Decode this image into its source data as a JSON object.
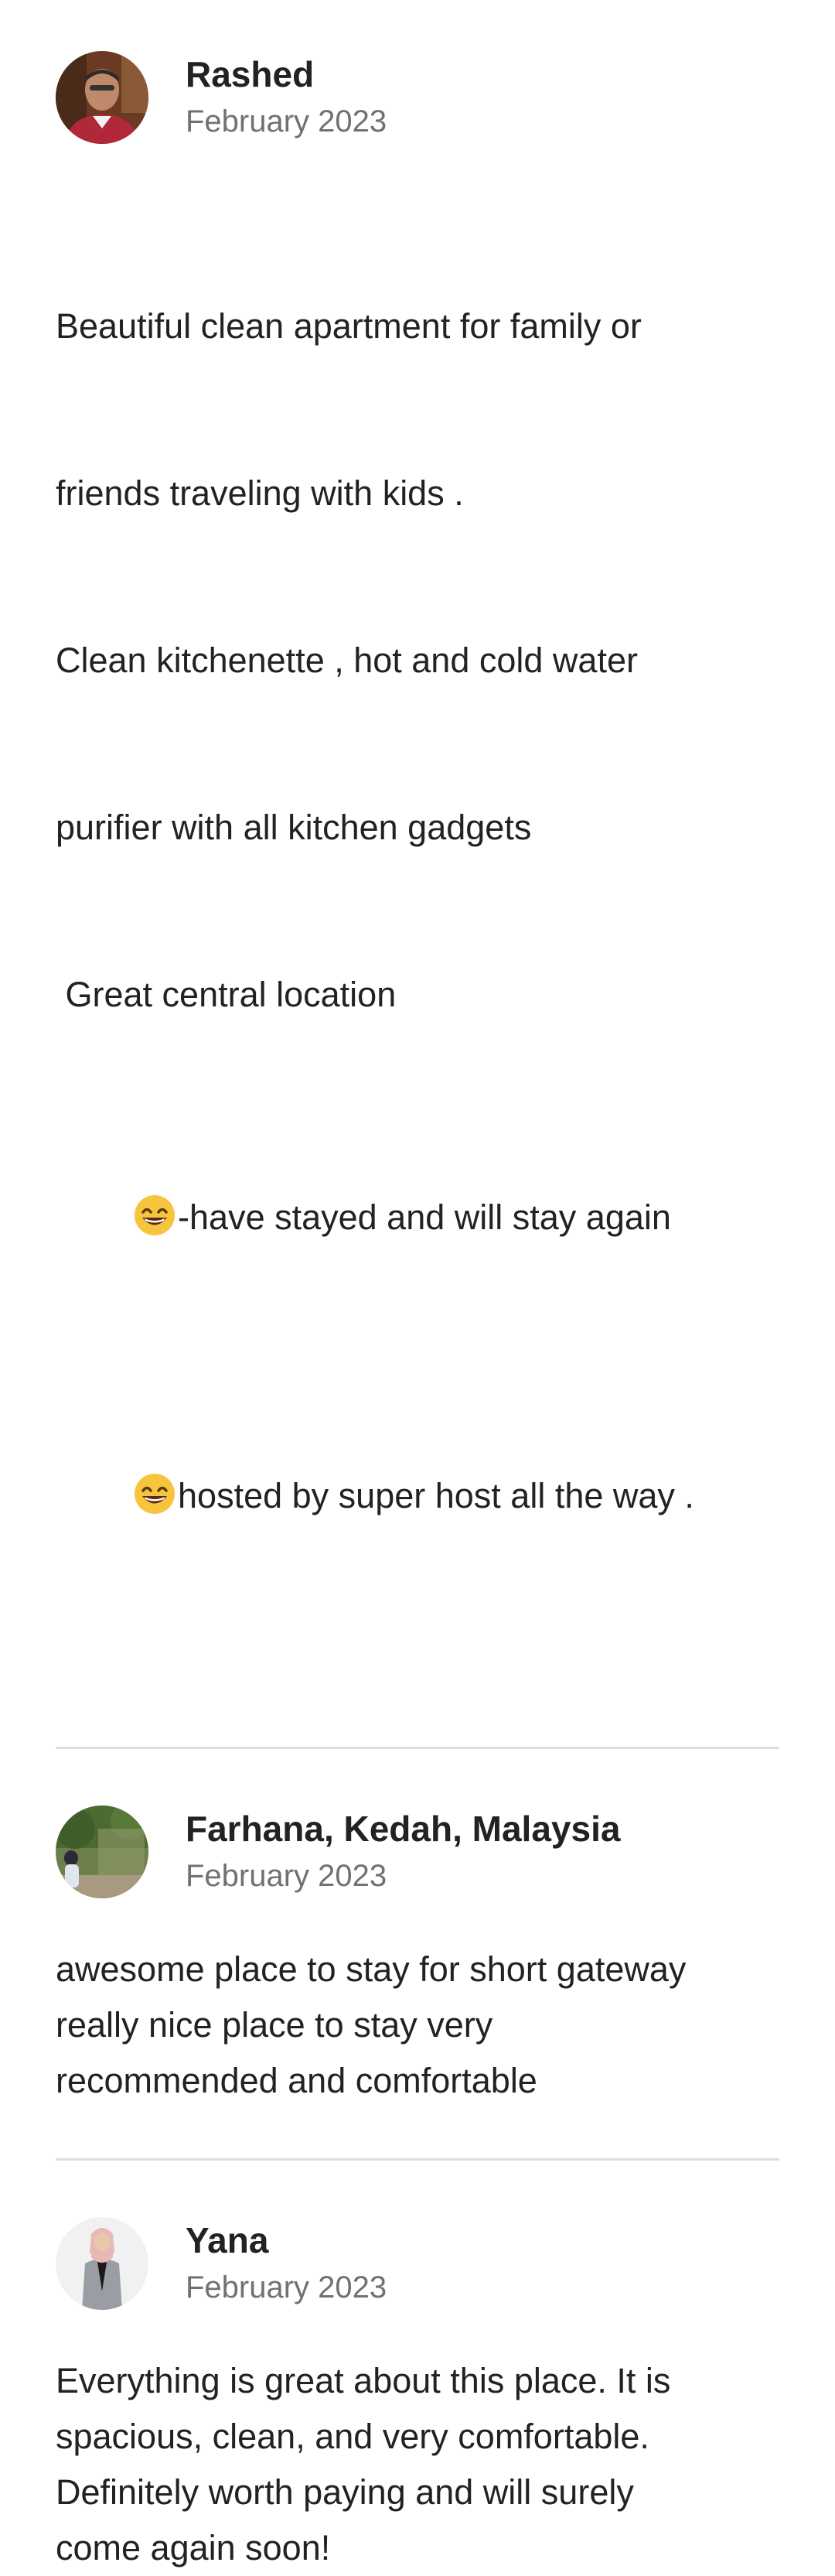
{
  "reviews": [
    {
      "name": "Rashed",
      "date": "February 2023",
      "avatar_icon": "person-photo-red-shirt",
      "lines": [
        "Beautiful clean apartment for family or",
        "friends traveling with kids .",
        "Clean kitchenette , hot and cold water",
        "purifier with all kitchen gadgets",
        " Great central location"
      ],
      "emoji_lines": [
        "-have stayed and will stay again",
        "hosted by super host all the way ."
      ],
      "emoji_icon": "grinning-face-emoji"
    },
    {
      "name": "Farhana, Kedah, Malaysia",
      "date": "February 2023",
      "avatar_icon": "person-in-garden-photo",
      "text": "awesome place to stay for short gateway\nreally nice place to stay very\nrecommended and comfortable"
    },
    {
      "name": "Yana",
      "date": "February 2023",
      "avatar_icon": "woman-in-hijab-photo",
      "text": "Everything is great about this place. It is\nspacious, clean, and very comfortable.\nDefinitely worth paying and will surely\ncome again soon!"
    }
  ],
  "colors": {
    "text_primary": "#222222",
    "text_secondary": "#717171",
    "divider": "#dddddd"
  }
}
